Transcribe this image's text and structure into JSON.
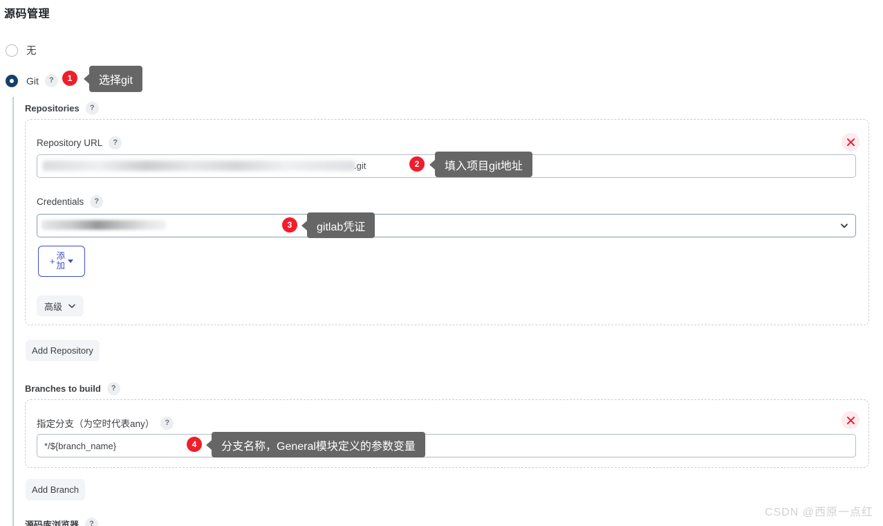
{
  "page": {
    "title": "源码管理",
    "watermark": "CSDN @西原一点红"
  },
  "scm_options": [
    {
      "label": "无",
      "selected": false
    },
    {
      "label": "Git",
      "selected": true,
      "help": "?"
    }
  ],
  "repositories": {
    "label": "Repositories",
    "help": "?",
    "repository_url": {
      "label": "Repository URL",
      "help": "?",
      "value_redacted": true,
      "visible_tail": ".git"
    },
    "credentials": {
      "label": "Credentials",
      "help": "?",
      "value_redacted": true,
      "caret_icon": "chevron-down-icon"
    },
    "add_credentials_button": {
      "plus": "+",
      "line1": "添",
      "line2": "加",
      "caret_icon": "caret-down-icon"
    },
    "advanced_button": {
      "label": "高级",
      "caret_icon": "chevron-down-icon"
    },
    "remove_icon": "close-icon",
    "add_repository_button": "Add Repository"
  },
  "branches": {
    "label": "Branches to build",
    "help": "?",
    "branch_specifier": {
      "label": "指定分支（为空时代表any）",
      "help": "?",
      "value": "*/${branch_name}"
    },
    "remove_icon": "close-icon",
    "add_branch_button": "Add Branch"
  },
  "repository_browser": {
    "label": "源码库浏览器",
    "help": "?"
  },
  "callouts": [
    {
      "number": "1",
      "text": "选择git"
    },
    {
      "number": "2",
      "text": "填入项目git地址"
    },
    {
      "number": "3",
      "text": "gitlab凭证"
    },
    {
      "number": "4",
      "text": "分支名称，General模块定义的参数变量"
    }
  ],
  "colors": {
    "marker_red": "#f01d2b",
    "tooltip_gray": "#666666",
    "radio_selected": "#13416b",
    "accent_blue": "#3b4ec4"
  }
}
